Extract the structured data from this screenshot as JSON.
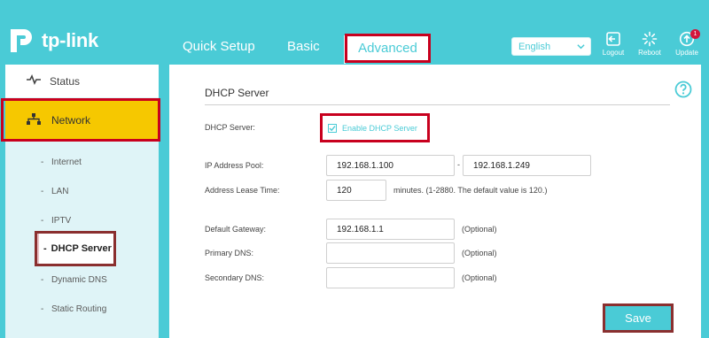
{
  "brand": {
    "name": "tp-link"
  },
  "nav": {
    "tabs": [
      {
        "label": "Quick Setup"
      },
      {
        "label": "Basic"
      },
      {
        "label": "Advanced",
        "active": true
      }
    ]
  },
  "header": {
    "language": "English",
    "logout_label": "Logout",
    "reboot_label": "Reboot",
    "update_label": "Update",
    "update_badge": "1"
  },
  "sidebar": {
    "status_label": "Status",
    "network_label": "Network",
    "sub_items": [
      {
        "label": "Internet"
      },
      {
        "label": "LAN"
      },
      {
        "label": "IPTV"
      },
      {
        "label": "DHCP Server",
        "active": true
      },
      {
        "label": "Dynamic DNS"
      },
      {
        "label": "Static Routing"
      }
    ]
  },
  "content": {
    "section_title": "DHCP Server",
    "dhcp_server_label": "DHCP Server:",
    "enable_label": "Enable DHCP Server",
    "enable_checked": true,
    "ip_pool_label": "IP Address Pool:",
    "ip_pool_start": "192.168.1.100",
    "ip_pool_separator": "-",
    "ip_pool_end": "192.168.1.249",
    "lease_label": "Address Lease Time:",
    "lease_value": "120",
    "lease_hint": "minutes. (1-2880. The default value is 120.)",
    "gateway_label": "Default Gateway:",
    "gateway_value": "192.168.1.1",
    "primary_dns_label": "Primary DNS:",
    "primary_dns_value": "",
    "secondary_dns_label": "Secondary DNS:",
    "secondary_dns_value": "",
    "optional_hint": "(Optional)",
    "save_label": "Save"
  },
  "colors": {
    "brand_teal": "#4acbd6",
    "network_yellow": "#f6c800",
    "highlight_red": "#c8001e",
    "highlight_brown": "#8a2f2f"
  }
}
